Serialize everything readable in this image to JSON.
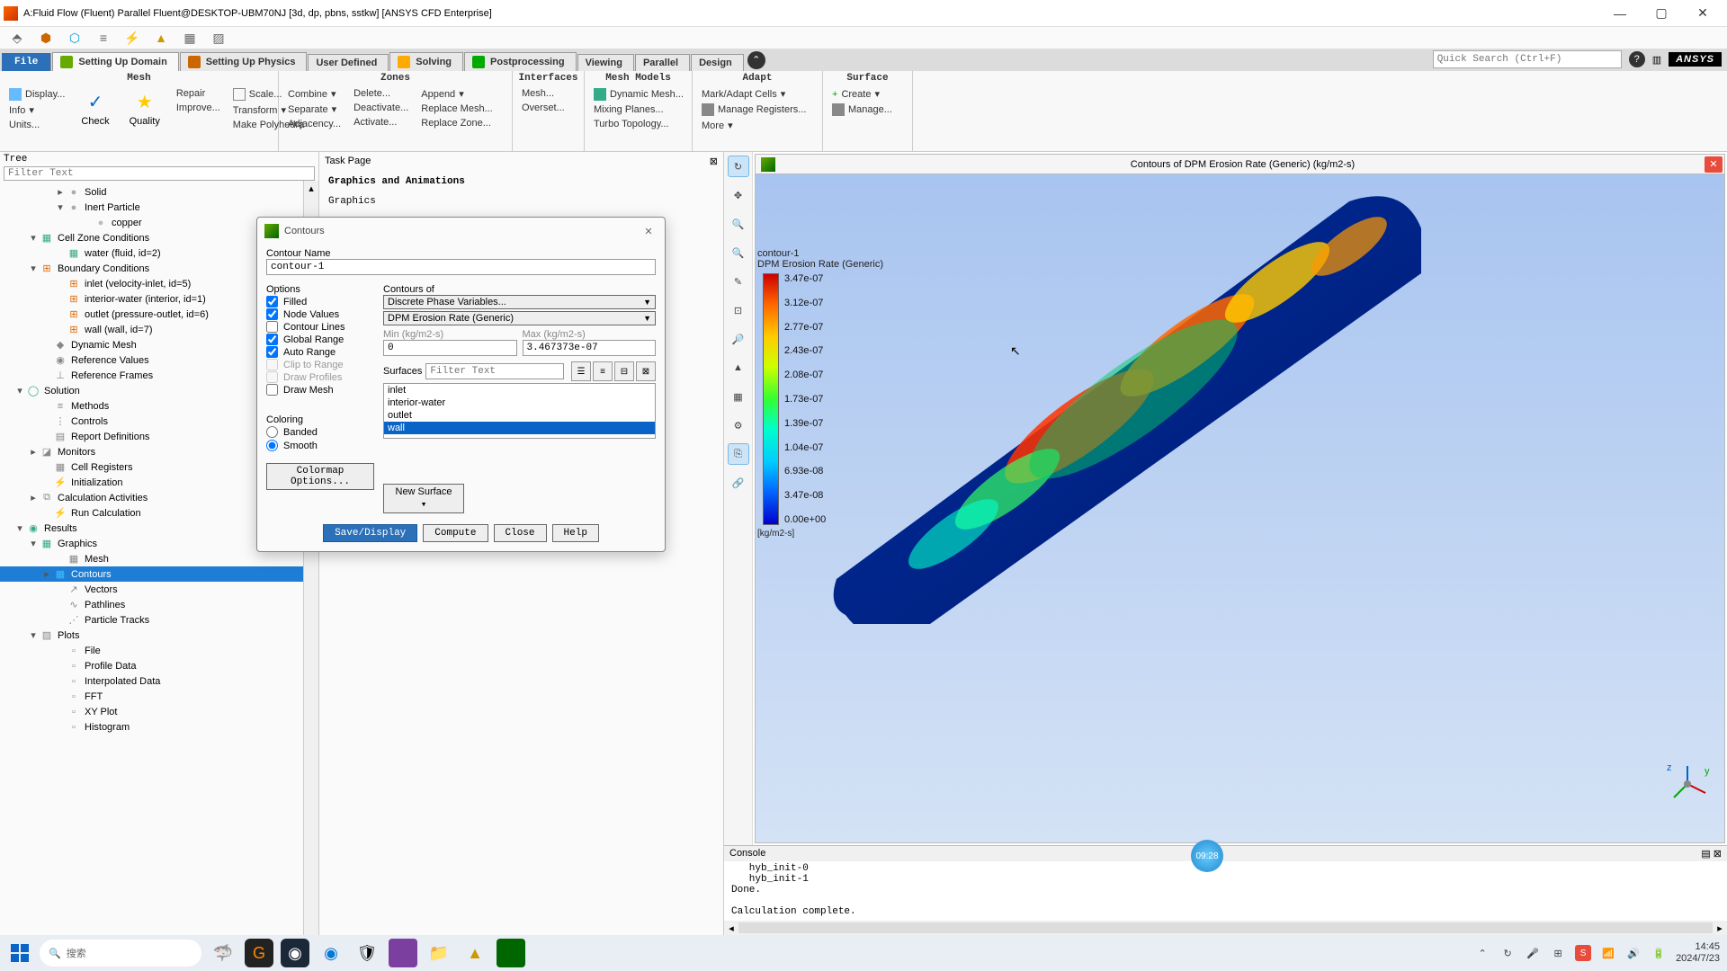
{
  "window": {
    "title": "A:Fluid Flow (Fluent) Parallel Fluent@DESKTOP-UBM70NJ  [3d, dp, pbns, sstkw] [ANSYS CFD Enterprise]"
  },
  "tabs": {
    "file": "File",
    "items": [
      "Setting Up Domain",
      "Setting Up Physics",
      "User Defined",
      "Solving",
      "Postprocessing",
      "Viewing",
      "Parallel",
      "Design"
    ]
  },
  "search_placeholder": "Quick Search (Ctrl+F)",
  "ansys_label": "ANSYS",
  "ribbon": {
    "mesh": {
      "hdr": "Mesh",
      "c0": [
        "Display...",
        "Info",
        "Units..."
      ],
      "big": [
        [
          "✓",
          "Check"
        ],
        [
          "★",
          "Quality"
        ]
      ],
      "c1": [
        "Repair",
        "Improve..."
      ],
      "c2": [
        "Scale...",
        "Transform",
        "Make Polyhedra"
      ]
    },
    "zones": {
      "hdr": "Zones",
      "c0": [
        "Combine",
        "Separate",
        "Adjacency..."
      ],
      "c1": [
        "Delete...",
        "Deactivate...",
        "Activate..."
      ],
      "c2": [
        "Append",
        "Replace Mesh...",
        "Replace Zone..."
      ]
    },
    "interfaces": {
      "hdr": "Interfaces",
      "c0": [
        "Mesh...",
        "Overset..."
      ]
    },
    "meshmodels": {
      "hdr": "Mesh Models",
      "c0": [
        "Dynamic Mesh...",
        "Mixing Planes...",
        "Turbo Topology..."
      ]
    },
    "adapt": {
      "hdr": "Adapt",
      "c0": [
        "Mark/Adapt Cells",
        "Manage Registers...",
        "More"
      ]
    },
    "surface": {
      "hdr": "Surface",
      "c0": [
        "Create",
        "Manage..."
      ]
    }
  },
  "tree": {
    "hdr": "Tree",
    "filter": "Filter Text",
    "rows": [
      {
        "pad": 60,
        "tw": "▸",
        "ico": "●",
        "color": "#aaa",
        "txt": "Solid"
      },
      {
        "pad": 60,
        "tw": "▾",
        "ico": "●",
        "color": "#aaa",
        "txt": "Inert Particle"
      },
      {
        "pad": 90,
        "tw": "",
        "ico": "●",
        "color": "#bbb",
        "txt": "copper"
      },
      {
        "pad": 30,
        "tw": "▾",
        "ico": "▦",
        "color": "#3a8",
        "txt": "Cell Zone Conditions"
      },
      {
        "pad": 60,
        "tw": "",
        "ico": "▦",
        "color": "#3a8",
        "txt": "water (fluid, id=2)"
      },
      {
        "pad": 30,
        "tw": "▾",
        "ico": "⊞",
        "color": "#d60",
        "txt": "Boundary Conditions"
      },
      {
        "pad": 60,
        "tw": "",
        "ico": "⊞",
        "color": "#d60",
        "txt": "inlet (velocity-inlet, id=5)"
      },
      {
        "pad": 60,
        "tw": "",
        "ico": "⊞",
        "color": "#d60",
        "txt": "interior-water (interior, id=1)"
      },
      {
        "pad": 60,
        "tw": "",
        "ico": "⊞",
        "color": "#d60",
        "txt": "outlet (pressure-outlet, id=6)"
      },
      {
        "pad": 60,
        "tw": "",
        "ico": "⊞",
        "color": "#d60",
        "txt": "wall (wall, id=7)"
      },
      {
        "pad": 45,
        "tw": "",
        "ico": "◆",
        "color": "#888",
        "txt": "Dynamic Mesh"
      },
      {
        "pad": 45,
        "tw": "",
        "ico": "◉",
        "color": "#888",
        "txt": "Reference Values"
      },
      {
        "pad": 45,
        "tw": "",
        "ico": "⊥",
        "color": "#888",
        "txt": "Reference Frames"
      },
      {
        "pad": 15,
        "tw": "▾",
        "ico": "◯",
        "color": "#3a8",
        "txt": "Solution"
      },
      {
        "pad": 45,
        "tw": "",
        "ico": "≡",
        "color": "#888",
        "txt": "Methods"
      },
      {
        "pad": 45,
        "tw": "",
        "ico": "⋮",
        "color": "#888",
        "txt": "Controls"
      },
      {
        "pad": 45,
        "tw": "",
        "ico": "▤",
        "color": "#888",
        "txt": "Report Definitions"
      },
      {
        "pad": 30,
        "tw": "▸",
        "ico": "◪",
        "color": "#888",
        "txt": "Monitors"
      },
      {
        "pad": 45,
        "tw": "",
        "ico": "▦",
        "color": "#888",
        "txt": "Cell Registers"
      },
      {
        "pad": 45,
        "tw": "",
        "ico": "⚡",
        "color": "#fa0",
        "txt": "Initialization"
      },
      {
        "pad": 30,
        "tw": "▸",
        "ico": "⧉",
        "color": "#888",
        "txt": "Calculation Activities"
      },
      {
        "pad": 45,
        "tw": "",
        "ico": "⚡",
        "color": "#fa0",
        "txt": "Run Calculation"
      },
      {
        "pad": 15,
        "tw": "▾",
        "ico": "◉",
        "color": "#3a8",
        "txt": "Results"
      },
      {
        "pad": 30,
        "tw": "▾",
        "ico": "▦",
        "color": "#3a8",
        "txt": "Graphics"
      },
      {
        "pad": 60,
        "tw": "",
        "ico": "▦",
        "color": "#888",
        "txt": "Mesh"
      },
      {
        "pad": 45,
        "tw": "▸",
        "ico": "▦",
        "color": "#4bf",
        "txt": "Contours",
        "sel": true
      },
      {
        "pad": 60,
        "tw": "",
        "ico": "↗",
        "color": "#888",
        "txt": "Vectors"
      },
      {
        "pad": 60,
        "tw": "",
        "ico": "∿",
        "color": "#888",
        "txt": "Pathlines"
      },
      {
        "pad": 60,
        "tw": "",
        "ico": "⋰",
        "color": "#888",
        "txt": "Particle Tracks"
      },
      {
        "pad": 30,
        "tw": "▾",
        "ico": "▨",
        "color": "#888",
        "txt": "Plots"
      },
      {
        "pad": 60,
        "tw": "",
        "ico": "▫",
        "color": "#888",
        "txt": "File"
      },
      {
        "pad": 60,
        "tw": "",
        "ico": "▫",
        "color": "#888",
        "txt": "Profile Data"
      },
      {
        "pad": 60,
        "tw": "",
        "ico": "▫",
        "color": "#888",
        "txt": "Interpolated Data"
      },
      {
        "pad": 60,
        "tw": "",
        "ico": "▫",
        "color": "#888",
        "txt": "FFT"
      },
      {
        "pad": 60,
        "tw": "",
        "ico": "▫",
        "color": "#888",
        "txt": "XY Plot"
      },
      {
        "pad": 60,
        "tw": "",
        "ico": "▫",
        "color": "#888",
        "txt": "Histogram"
      }
    ]
  },
  "task": {
    "hdr": "Task Page",
    "title": "Graphics and Animations",
    "sub": "Graphics"
  },
  "dialog": {
    "title": "Contours",
    "name_label": "Contour Name",
    "name_value": "contour-1",
    "options_label": "Options",
    "opts": [
      {
        "label": "Filled",
        "ck": true
      },
      {
        "label": "Node Values",
        "ck": true
      },
      {
        "label": "Contour Lines",
        "ck": false
      },
      {
        "label": "Global Range",
        "ck": true
      },
      {
        "label": "Auto Range",
        "ck": true
      },
      {
        "label": "Clip to Range",
        "ck": false,
        "dis": true
      },
      {
        "label": "Draw Profiles",
        "ck": false,
        "dis": true
      },
      {
        "label": "Draw Mesh",
        "ck": false
      }
    ],
    "contours_of": "Contours of",
    "sel1": "Discrete Phase Variables...",
    "sel2": "DPM Erosion Rate (Generic)",
    "min_label": "Min (kg/m2-s)",
    "min_val": "0",
    "max_label": "Max (kg/m2-s)",
    "max_val": "3.467373e-07",
    "surfaces_label": "Surfaces",
    "surf_filter": "Filter Text",
    "surf_list": [
      "inlet",
      "interior-water",
      "outlet",
      "wall"
    ],
    "surf_sel": "wall",
    "coloring_label": "Coloring",
    "coloring": [
      {
        "label": "Banded",
        "ck": false
      },
      {
        "label": "Smooth",
        "ck": true
      }
    ],
    "colormap_btn": "Colormap Options...",
    "newsurf_btn": "New Surface",
    "buttons": [
      "Save/Display",
      "Compute",
      "Close",
      "Help"
    ]
  },
  "gfx": {
    "title": "Contours of DPM Erosion Rate (Generic) (kg/m2-s)",
    "caption1": "contour-1",
    "caption2": "DPM Erosion Rate (Generic)",
    "unit": "[kg/m2-s]",
    "levels": [
      "3.47e-07",
      "3.12e-07",
      "2.77e-07",
      "2.43e-07",
      "2.08e-07",
      "1.73e-07",
      "1.39e-07",
      "1.04e-07",
      "6.93e-08",
      "3.47e-08",
      "0.00e+00"
    ]
  },
  "console": {
    "hdr": "Console",
    "body": "   hyb_init-0\n   hyb_init-1\nDone.\n\nCalculation complete."
  },
  "taskbar": {
    "search": "搜索",
    "time": "14:45",
    "date": "2024/7/23"
  },
  "clock_badge": "09:28"
}
